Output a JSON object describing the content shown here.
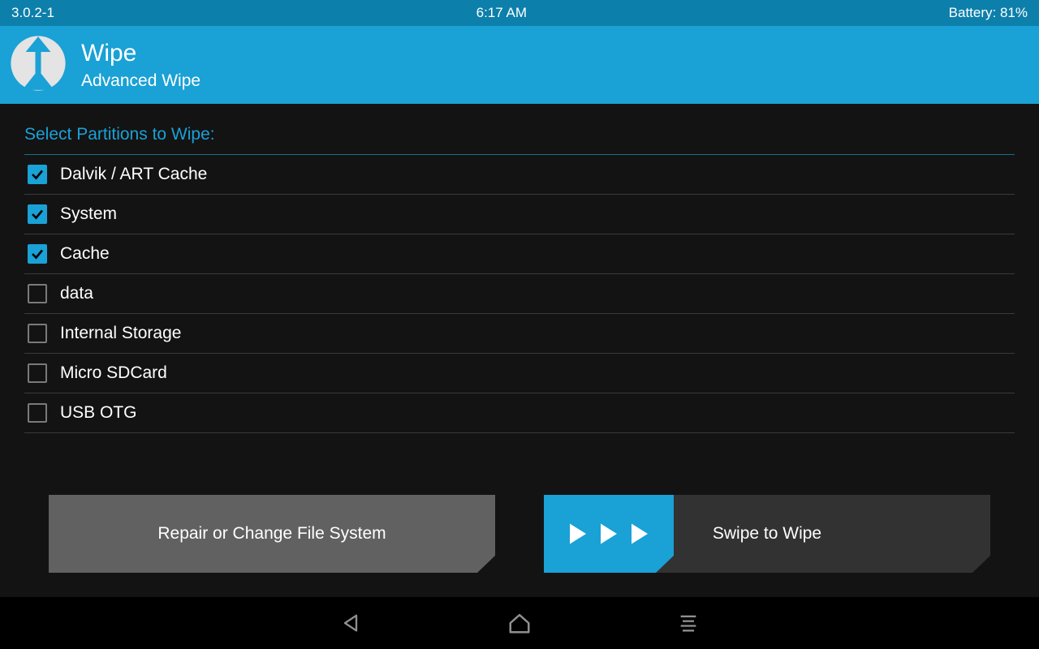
{
  "status": {
    "version": "3.0.2-1",
    "time": "6:17 AM",
    "battery": "Battery: 81%"
  },
  "header": {
    "title": "Wipe",
    "subtitle": "Advanced Wipe"
  },
  "section_label": "Select Partitions to Wipe:",
  "partitions": [
    {
      "label": "Dalvik / ART Cache",
      "checked": true
    },
    {
      "label": "System",
      "checked": true
    },
    {
      "label": "Cache",
      "checked": true
    },
    {
      "label": "data",
      "checked": false
    },
    {
      "label": "Internal Storage",
      "checked": false
    },
    {
      "label": "Micro SDCard",
      "checked": false
    },
    {
      "label": "USB OTG",
      "checked": false
    }
  ],
  "buttons": {
    "repair": "Repair or Change File System",
    "swipe": "Swipe to Wipe"
  }
}
